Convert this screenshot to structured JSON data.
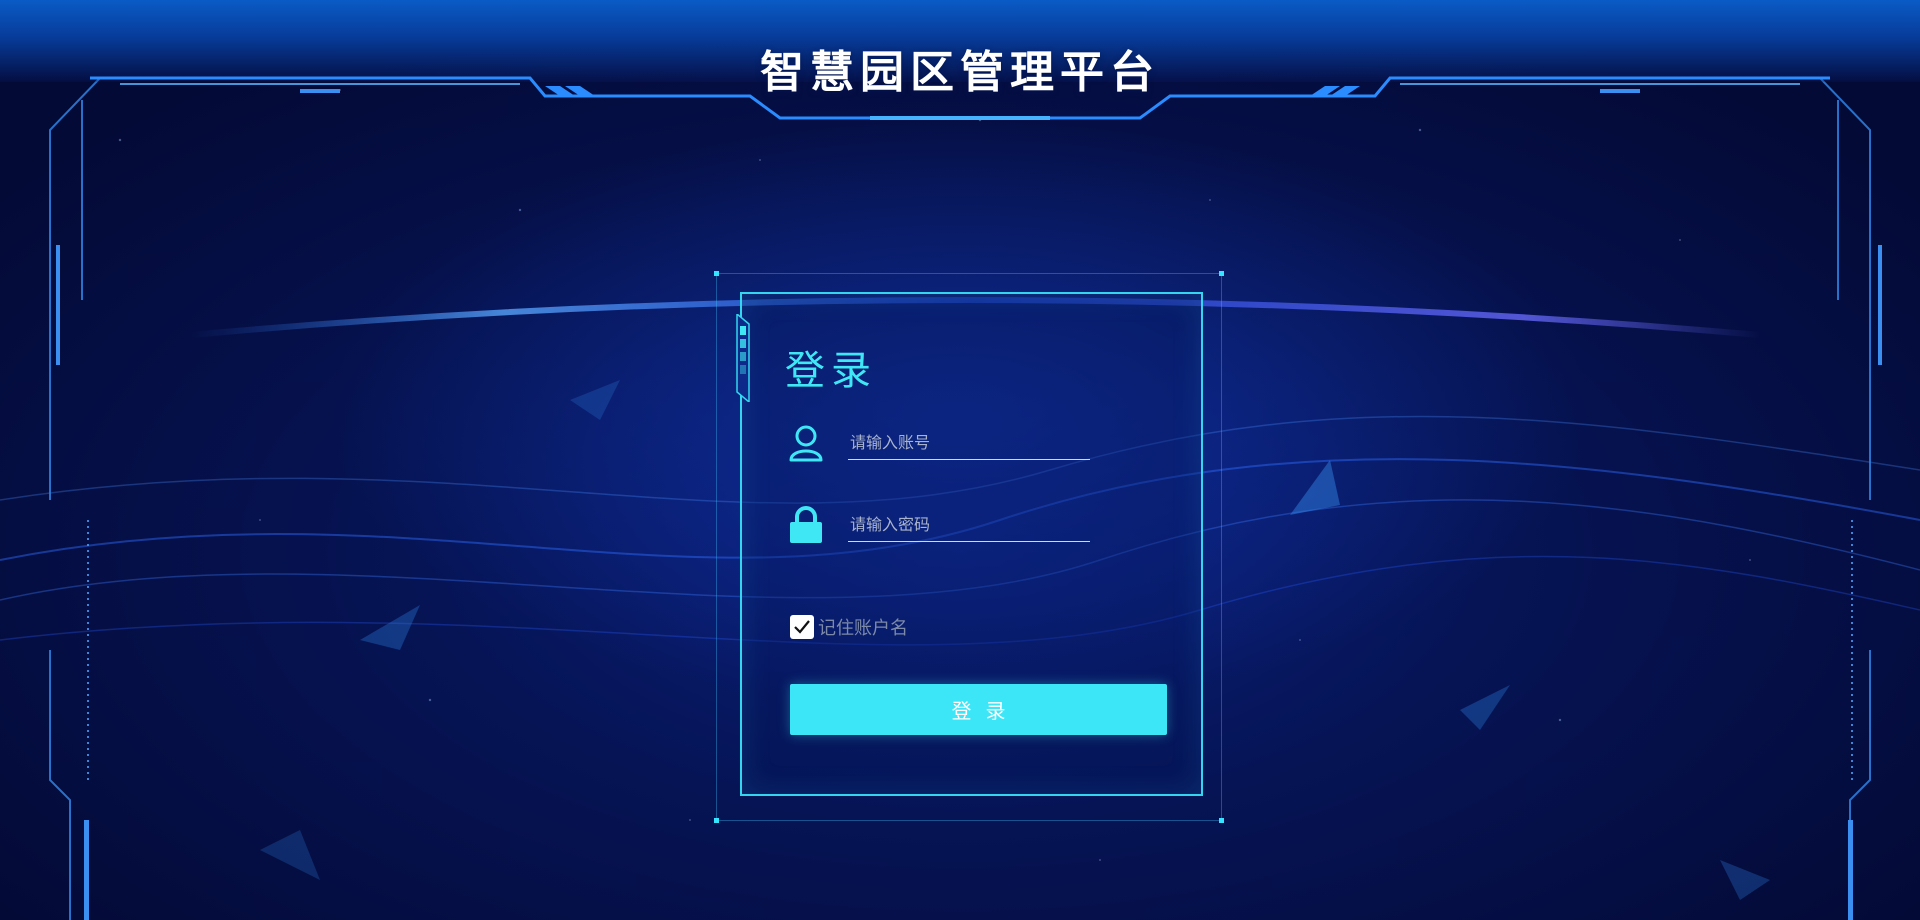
{
  "header": {
    "title": "智慧园区管理平台"
  },
  "login": {
    "title": "登录",
    "username_placeholder": "请输入账号",
    "password_placeholder": "请输入密码",
    "remember_label": "记住账户名",
    "remember_checked": true,
    "submit_label": "登录"
  },
  "icons": {
    "user": "user-icon",
    "lock": "lock-icon",
    "check": "check-icon"
  },
  "colors": {
    "accent": "#3de6f7",
    "frame": "#33d6ee",
    "background": "#061455"
  }
}
